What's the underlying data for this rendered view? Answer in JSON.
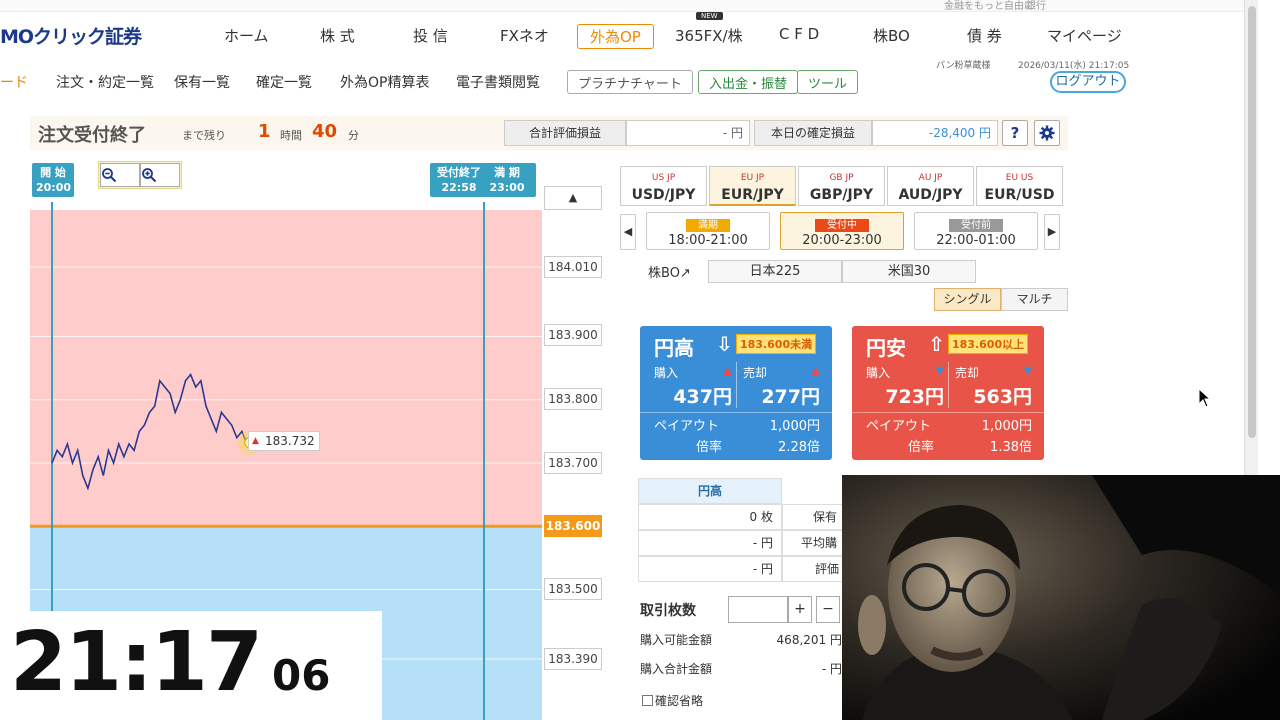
{
  "top_strip": {
    "left_text": "金融をもっと自由に",
    "right_text": "銀行"
  },
  "header": {
    "logo": "MOクリック証券",
    "nav": [
      "ホーム",
      "株 式",
      "投 信",
      "FXネオ",
      "外為OP",
      "365FX/株",
      "C F D",
      "株BO",
      "債 券",
      "マイページ"
    ],
    "new_badge": "NEW"
  },
  "subnav": {
    "partial": "ード",
    "links": [
      "注文・約定一覧",
      "保有一覧",
      "確定一覧",
      "外為OP精算表",
      "電子書類閲覧"
    ],
    "buttons": [
      "プラチナチャート",
      "入出金・振替",
      "ツール"
    ],
    "user": "パン粉草蔵様",
    "timestamp": "2026/03/11(水) 21:17:05",
    "logout": "ログアウト"
  },
  "status": {
    "title": "注文受付終了",
    "remain_label": "まで残り",
    "hours": "1",
    "hours_unit": "時間",
    "minutes": "40",
    "minutes_unit": "分",
    "total_eval_label": "合計評価損益",
    "total_eval_value": "- 円",
    "today_label": "本日の確定損益",
    "today_value": "-28,400 円",
    "help": "?",
    "settings_icon": "gear-icon"
  },
  "chart": {
    "start_label": "開 始",
    "start_time": "20:00",
    "deadline_label": "受付終了",
    "deadline_time": "22:58",
    "expiry_label": "満 期",
    "expiry_time": "23:00",
    "zoom_out": "－",
    "zoom_in": "＋",
    "scroll_up": "▲",
    "price_ticks": [
      "184.010",
      "183.900",
      "183.800",
      "183.700",
      "183.600",
      "183.500",
      "183.390"
    ],
    "strike": "183.600",
    "current_price": "183.732",
    "current_arrow": "▲"
  },
  "chart_data": {
    "type": "line",
    "xlabel": "",
    "ylabel": "",
    "x_range": [
      "20:00",
      "23:00"
    ],
    "ylim": [
      183.35,
      184.06
    ],
    "strike": 183.6,
    "series": [
      {
        "x": [
          "20:00",
          "20:02",
          "20:04",
          "20:06",
          "20:08",
          "20:10",
          "20:12",
          "20:14",
          "20:16",
          "20:18",
          "20:20",
          "20:22",
          "20:24",
          "20:26",
          "20:28",
          "20:30",
          "20:32",
          "20:34",
          "20:36",
          "20:38",
          "20:40",
          "20:42",
          "20:44",
          "20:46",
          "20:48",
          "20:50",
          "20:52",
          "20:54",
          "20:56",
          "20:58",
          "21:00",
          "21:02",
          "21:04",
          "21:06",
          "21:08",
          "21:10",
          "21:12",
          "21:14",
          "21:16",
          "21:17"
        ],
        "values": [
          183.7,
          183.72,
          183.71,
          183.73,
          183.7,
          183.72,
          183.68,
          183.66,
          183.69,
          183.71,
          183.68,
          183.72,
          183.7,
          183.73,
          183.71,
          183.73,
          183.72,
          183.75,
          183.76,
          183.78,
          183.79,
          183.83,
          183.82,
          183.81,
          183.78,
          183.8,
          183.83,
          183.84,
          183.82,
          183.83,
          183.79,
          183.77,
          183.75,
          183.78,
          183.77,
          183.76,
          183.74,
          183.75,
          183.73,
          183.732
        ]
      }
    ]
  },
  "pairs": [
    {
      "flags": "US JP",
      "name": "USD/JPY"
    },
    {
      "flags": "EU JP",
      "name": "EUR/JPY"
    },
    {
      "flags": "GB JP",
      "name": "GBP/JPY"
    },
    {
      "flags": "AU JP",
      "name": "AUD/JPY"
    },
    {
      "flags": "EU US",
      "name": "EUR/USD"
    }
  ],
  "rounds": [
    {
      "badge": "満期",
      "time": "18:00-21:00",
      "color": "#f2a900"
    },
    {
      "badge": "受付中",
      "time": "20:00-23:00",
      "color": "#ea4a18"
    },
    {
      "badge": "受付前",
      "time": "22:00-01:00",
      "color": "#999999"
    }
  ],
  "round_prev": "◀",
  "round_next": "▶",
  "stockbo": {
    "label": "株BO↗",
    "items": [
      "日本225",
      "米国30"
    ]
  },
  "modes": [
    "シングル",
    "マルチ"
  ],
  "panel_high": {
    "title": "円高",
    "arrow": "⇩",
    "condition": "183.600未満",
    "buy_label": "購入",
    "buy_price": "437円",
    "sell_label": "売却",
    "sell_price": "277円",
    "payout_label": "ペイアウト",
    "payout": "1,000円",
    "rate_label": "倍率",
    "rate": "2.28倍",
    "buy_tri": "▲",
    "sell_tri": "▲"
  },
  "panel_low": {
    "title": "円安",
    "arrow": "⇧",
    "condition": "183.600以上",
    "buy_label": "購入",
    "buy_price": "723円",
    "sell_label": "売却",
    "sell_price": "563円",
    "payout_label": "ペイアウト",
    "payout": "1,000円",
    "rate_label": "倍率",
    "rate": "1.38倍",
    "buy_tri": "▼",
    "sell_tri": "▼"
  },
  "positions": {
    "header": "円高",
    "rows": [
      {
        "value": "0 枚",
        "label": "保有"
      },
      {
        "value": "- 円",
        "label": "平均購"
      },
      {
        "value": "- 円",
        "label": "評価"
      }
    ]
  },
  "order": {
    "qty_label": "取引枚数",
    "qty_value": "",
    "plus": "+",
    "minus": "−",
    "available_label": "購入可能金額",
    "available_value": "468,201 円",
    "total_label": "購入合計金額",
    "total_value": "- 円",
    "confirm_skip": "確認省略"
  },
  "clock": {
    "hm": "21:17",
    "sec": "06"
  },
  "colors": {
    "above_zone": "#ffcccc",
    "below_zone": "#b5e0f8",
    "strike_line": "#f39a1a",
    "price_line": "#2b3990",
    "marker": "#38a0c0",
    "panel_blue": "#3a8ed8",
    "panel_red": "#e85548"
  }
}
